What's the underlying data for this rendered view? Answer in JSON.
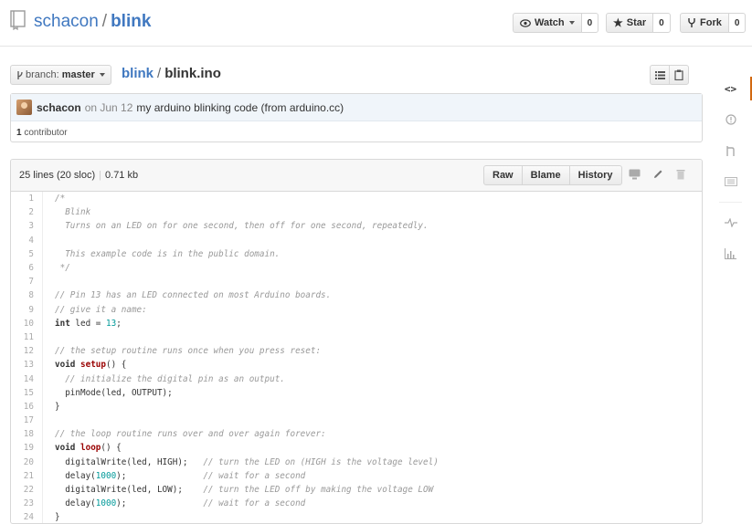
{
  "header": {
    "owner": "schacon",
    "separator": "/",
    "repo": "blink",
    "watch_label": "Watch",
    "watch_count": "0",
    "star_label": "Star",
    "star_count": "0",
    "fork_label": "Fork",
    "fork_count": "0"
  },
  "filenav": {
    "branch_prefix": "branch:",
    "branch_name": "master",
    "crumb_root": "blink",
    "crumb_sep": "/",
    "crumb_file": "blink.ino"
  },
  "commit": {
    "author": "schacon",
    "date": "on Jun 12",
    "message": "my arduino blinking code (from arduino.cc)",
    "contributors_count": "1",
    "contributors_label": "contributor"
  },
  "file": {
    "lines_info": "25 lines (20 sloc)",
    "size": "0.71 kb",
    "raw_label": "Raw",
    "blame_label": "Blame",
    "history_label": "History"
  },
  "code_lines": [
    "/*",
    "  Blink",
    "  Turns on an LED on for one second, then off for one second, repeatedly.",
    "",
    "  This example code is in the public domain.",
    " */",
    "",
    "// Pin 13 has an LED connected on most Arduino boards.",
    "// give it a name:",
    "int led = 13;",
    "",
    "// the setup routine runs once when you press reset:",
    "void setup() {",
    "  // initialize the digital pin as an output.",
    "  pinMode(led, OUTPUT);",
    "}",
    "",
    "// the loop routine runs over and over again forever:",
    "void loop() {",
    "  digitalWrite(led, HIGH);   // turn the LED on (HIGH is the voltage level)",
    "  delay(1000);               // wait for a second",
    "  digitalWrite(led, LOW);    // turn the LED off by making the voltage LOW",
    "  delay(1000);               // wait for a second",
    "}"
  ],
  "colors": {
    "link": "#4078c0",
    "accent": "#d26911",
    "commit_bg": "#f0f5fa"
  }
}
